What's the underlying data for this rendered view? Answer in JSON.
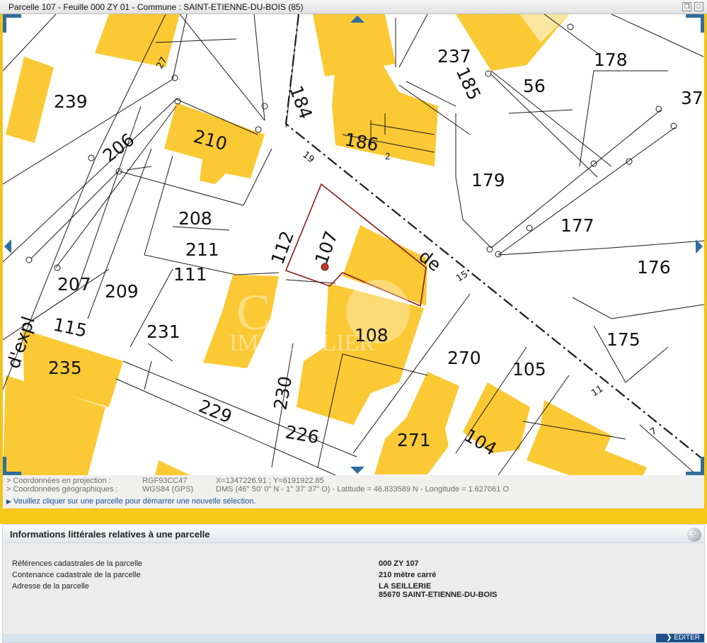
{
  "window": {
    "title": "Parcelle 107 - Feuille 000 ZY 01 - Commune : SAINT-ETIENNE-DU-BOIS (85)",
    "restore_icon": "restore-window-icon",
    "close_icon": "close-window-icon"
  },
  "map": {
    "parcel_labels": [
      "239",
      "206",
      "210",
      "27",
      "208",
      "211",
      "111",
      "207",
      "209",
      "115",
      "231",
      "235",
      "d'expl",
      "229",
      "226",
      "230",
      "112",
      "107",
      "108",
      "184",
      "186",
      "2",
      "237",
      "185",
      "56",
      "178",
      "37",
      "179",
      "177",
      "176",
      "175",
      "19",
      "de",
      "15",
      "270",
      "105",
      "271",
      "104",
      "11",
      "7"
    ],
    "watermark_top": "C",
    "watermark_bottom": "IMMOBILIER",
    "colors": {
      "building": "#fbc934",
      "selected_parcel": "#8b1a1a",
      "lines": "#1a1a1a",
      "accent": "#2f6e9e"
    }
  },
  "coords": {
    "proj_label": "> Coordonnées en projection :",
    "proj_system": "RGF93CC47",
    "proj_value": "X=1347226.91 ; Y=6191922.85",
    "geo_label": "> Coordonnées géographiques :",
    "geo_system": "WGS84 (GPS)",
    "geo_value": "DMS (46° 50' 0\" N - 1° 37' 37\" O) - Latitude = 46.833589 N - Longitude = 1.627061 O",
    "hint": "Veuillez cliquer sur une parcelle pour démarrer une nouvelle sélection."
  },
  "panel": {
    "title": "Informations littérales relatives à une parcelle",
    "help_label": "?",
    "rows": [
      {
        "label": "Références cadastrales de la parcelle",
        "value": "000 ZY 107"
      },
      {
        "label": "Contenance cadastrale de la parcelle",
        "value": "210 mètre carré"
      },
      {
        "label": "Adresse de la parcelle",
        "value": "LA SEILLERIE",
        "value2": "85670 SAINT-ETIENNE-DU-BOIS"
      }
    ],
    "edit_label": "ÉDITER"
  }
}
